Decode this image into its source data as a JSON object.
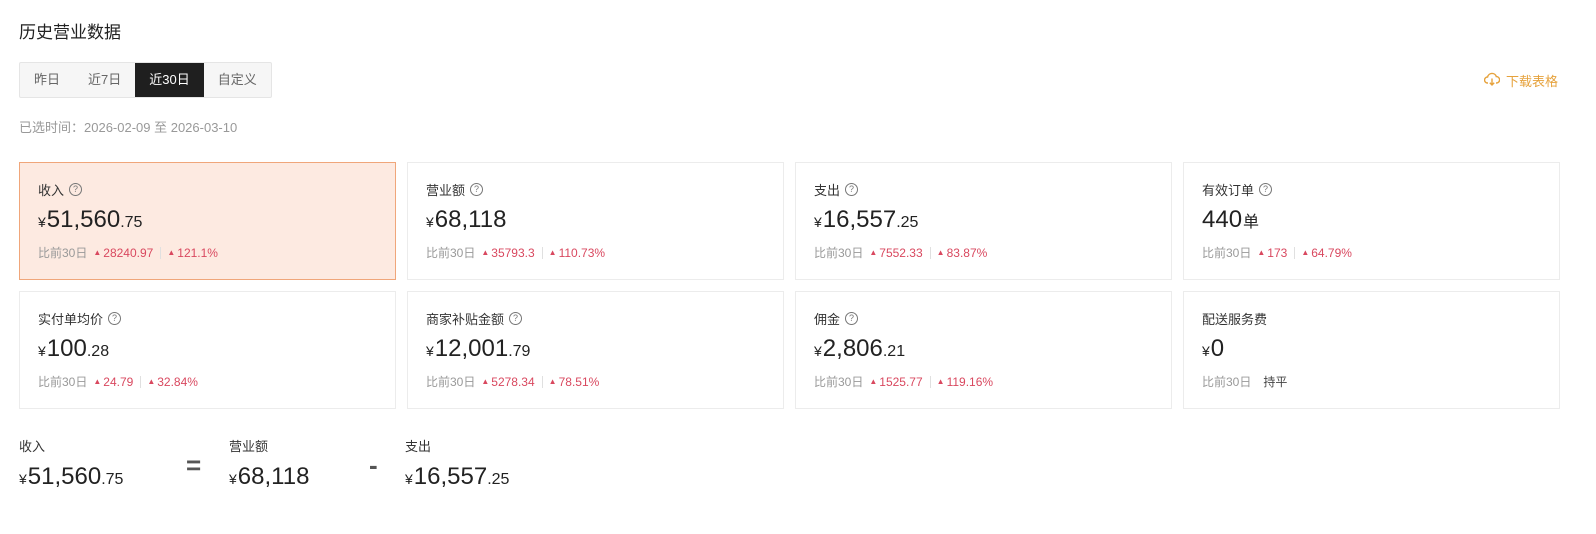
{
  "title": "历史营业数据",
  "tabs": [
    {
      "label": "昨日"
    },
    {
      "label": "近7日"
    },
    {
      "label": "近30日"
    },
    {
      "label": "自定义"
    }
  ],
  "active_tab": "近30日",
  "download_label": "下载表格",
  "range_text": "已选时间：2026-02-09 至 2026-03-10",
  "cards": [
    {
      "label": "收入",
      "currency": "¥",
      "int": "51,560",
      "dec": ".75",
      "unit": "",
      "compare_label": "比前30日",
      "delta": "28240.97",
      "pct": "121.1%"
    },
    {
      "label": "营业额",
      "currency": "¥",
      "int": "68,118",
      "dec": "",
      "unit": "",
      "compare_label": "比前30日",
      "delta": "35793.3",
      "pct": "110.73%"
    },
    {
      "label": "支出",
      "currency": "¥",
      "int": "16,557",
      "dec": ".25",
      "unit": "",
      "compare_label": "比前30日",
      "delta": "7552.33",
      "pct": "83.87%"
    },
    {
      "label": "有效订单",
      "currency": "",
      "int": "440",
      "dec": "",
      "unit": "单",
      "compare_label": "比前30日",
      "delta": "173",
      "pct": "64.79%"
    },
    {
      "label": "实付单均价",
      "currency": "¥",
      "int": "100",
      "dec": ".28",
      "unit": "",
      "compare_label": "比前30日",
      "delta": "24.79",
      "pct": "32.84%"
    },
    {
      "label": "商家补贴金额",
      "currency": "¥",
      "int": "12,001",
      "dec": ".79",
      "unit": "",
      "compare_label": "比前30日",
      "delta": "5278.34",
      "pct": "78.51%"
    },
    {
      "label": "佣金",
      "currency": "¥",
      "int": "2,806",
      "dec": ".21",
      "unit": "",
      "compare_label": "比前30日",
      "delta": "1525.77",
      "pct": "119.16%"
    },
    {
      "label": "配送服务费",
      "currency": "¥",
      "int": "0",
      "dec": "",
      "unit": "",
      "compare_label": "比前30日",
      "flat": "持平"
    }
  ],
  "formula": {
    "a": {
      "label": "收入",
      "currency": "¥",
      "int": "51,560",
      "dec": ".75"
    },
    "op1": "=",
    "b": {
      "label": "营业额",
      "currency": "¥",
      "int": "68,118",
      "dec": ""
    },
    "op2": "-",
    "c": {
      "label": "支出",
      "currency": "¥",
      "int": "16,557",
      "dec": ".25"
    }
  },
  "colors": {
    "accent_dark": "#1f1f1f",
    "up_red": "#d9485f",
    "download": "#e6a23c",
    "active_card_bg": "#fdeae1",
    "active_card_border": "#f0a67a"
  },
  "icons": {
    "download": "cloud-download-icon",
    "help": "question-circle-icon",
    "trend": "up-arrow-icon"
  }
}
